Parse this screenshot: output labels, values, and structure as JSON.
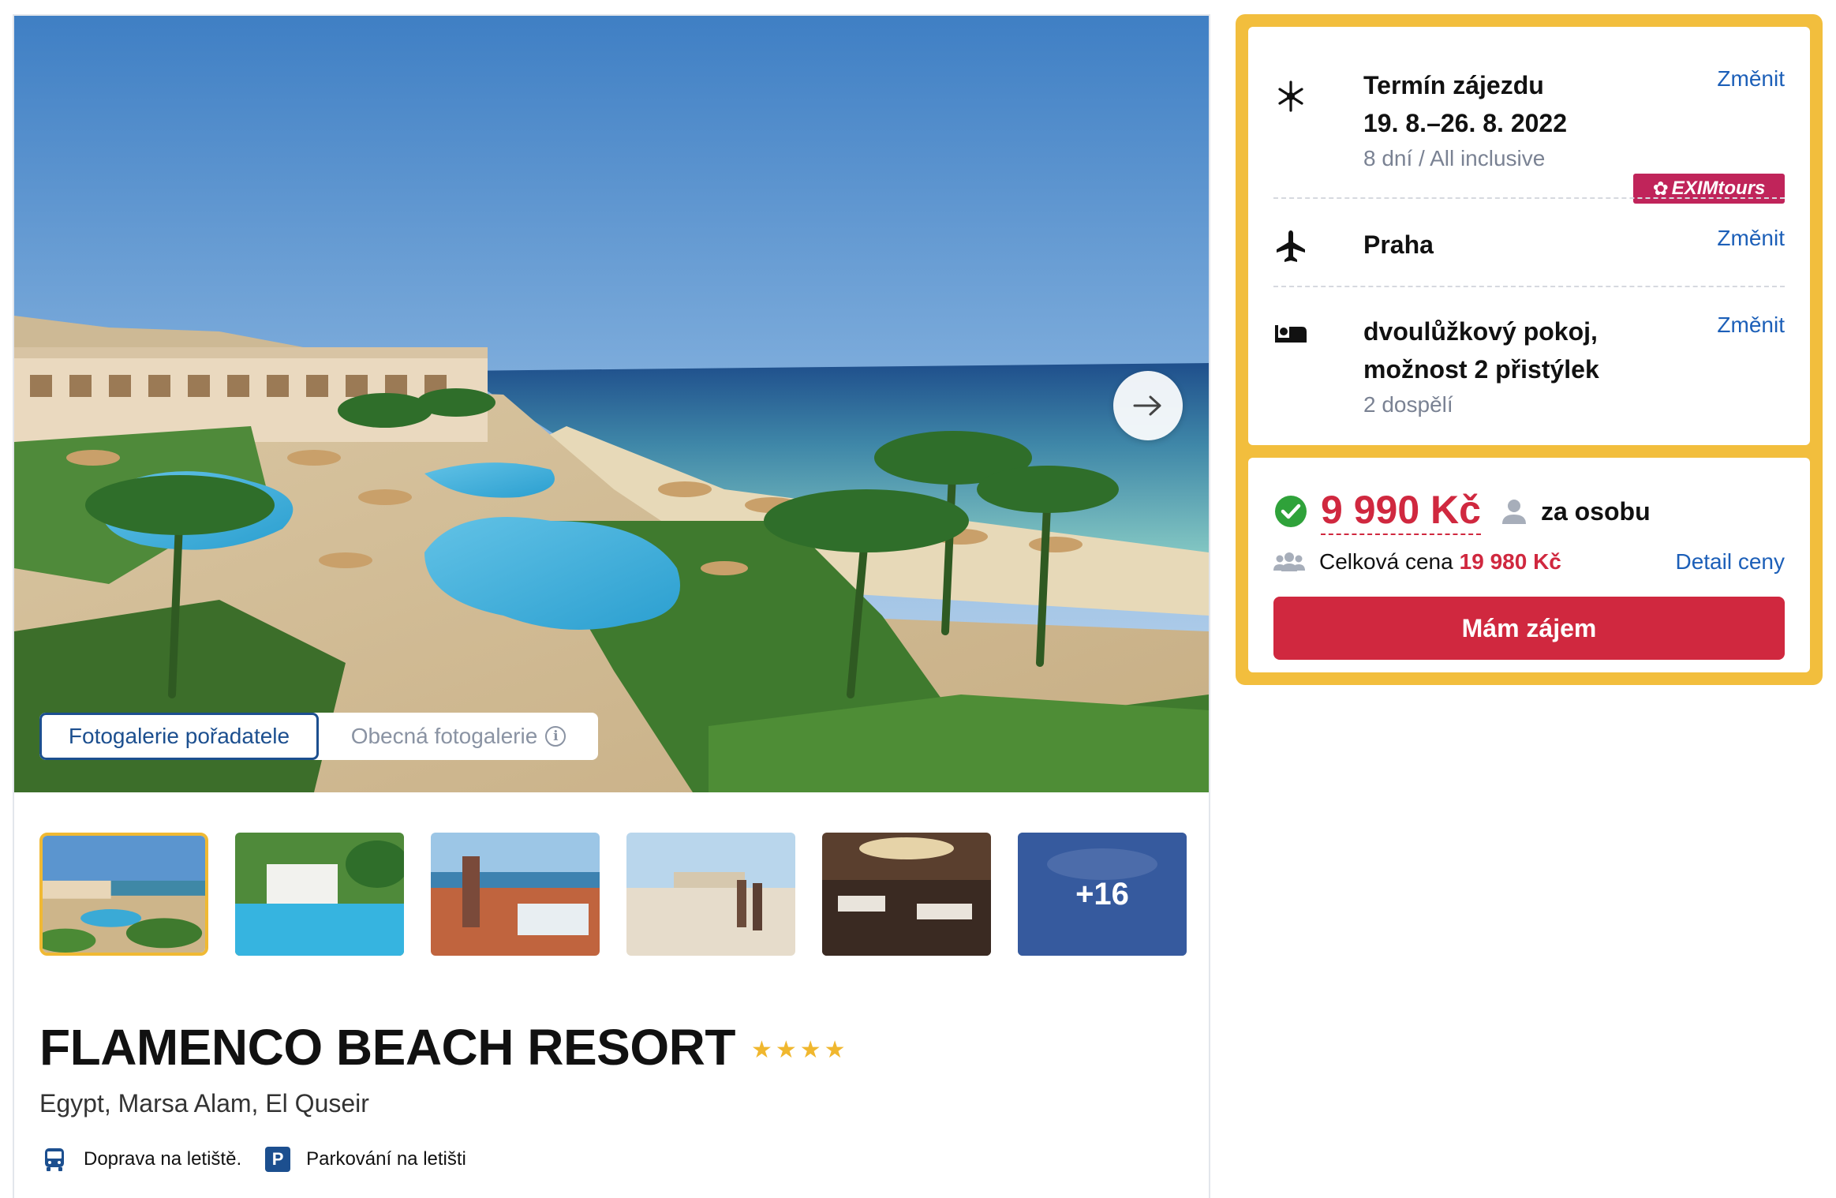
{
  "gallery": {
    "tabs": {
      "organizer": "Fotogalerie pořadatele",
      "general": "Obecná fotogalerie"
    },
    "more_count": "+16",
    "thumbnail_count": 6,
    "selected_thumbnail": 1
  },
  "hotel": {
    "name": "FLAMENCO BEACH RESORT",
    "star_rating": 4,
    "location": "Egypt, Marsa Alam, El Quseir",
    "amenities": [
      {
        "icon": "bus-icon",
        "label": "Doprava na letiště."
      },
      {
        "icon": "parking-icon",
        "label": "Parkování na letišti",
        "glyph": "P"
      }
    ]
  },
  "booking": {
    "term": {
      "title": "Termín zájezdu",
      "dates": "19. 8.–26. 8. 2022",
      "sub": "8 dní / All inclusive",
      "change": "Změnit",
      "operator_logo": "EXIMtours"
    },
    "departure": {
      "title": "Praha",
      "change": "Změnit"
    },
    "room": {
      "title_line1": "dvoulůžkový pokoj,",
      "title_line2": "možnost 2 přistýlek",
      "sub": "2 dospělí",
      "change": "Změnit"
    },
    "price": {
      "per_person": "9 990 Kč",
      "per_person_label": "za osobu",
      "total_label": "Celková cena",
      "total_value": "19 980 Kč",
      "detail_link": "Detail ceny",
      "cta": "Mám zájem"
    }
  },
  "colors": {
    "accent_red": "#d0283f",
    "link_blue": "#1c5fb8",
    "frame_yellow": "#f2be3d",
    "star_gold": "#f0b72e",
    "brand_navy": "#1c4f8f",
    "operator_magenta": "#c0245a"
  }
}
